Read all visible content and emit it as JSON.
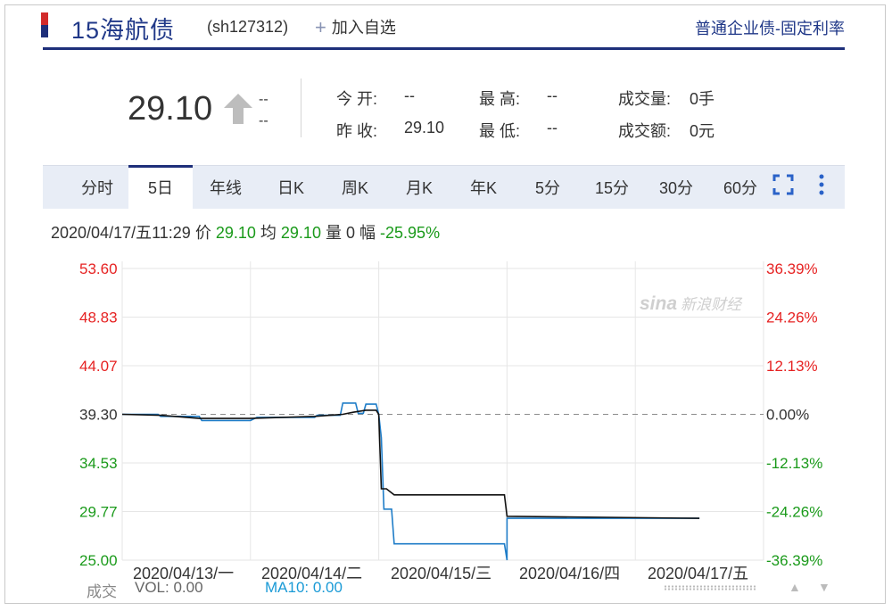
{
  "header": {
    "name": "15海航债",
    "code": "(sh127312)",
    "add_fav_label": "加入自选",
    "bond_type": "普通企业债-固定利率"
  },
  "quote": {
    "price": "29.10",
    "change": "--",
    "change_pct": "--",
    "open_label": "今 开:",
    "open": "--",
    "prev_close_label": "昨 收:",
    "prev_close": "29.10",
    "high_label": "最 高:",
    "high": "--",
    "low_label": "最 低:",
    "low": "--",
    "volume_label": "成交量:",
    "volume": "0手",
    "amount_label": "成交额:",
    "amount": "0元"
  },
  "tabs": [
    "分时",
    "5日",
    "年线",
    "日K",
    "周K",
    "月K",
    "年K",
    "5分",
    "15分",
    "30分",
    "60分"
  ],
  "active_tab": "5日",
  "info": {
    "datetime": "2020/04/17/五11:29",
    "price_label": "价",
    "price": "29.10",
    "avg_label": "均",
    "avg": "29.10",
    "vol_label": "量",
    "vol": "0",
    "range_label": "幅",
    "range": "-25.95%"
  },
  "watermark": "新浪财经",
  "watermark_logo": "sina",
  "colors": {
    "up": "#e62222",
    "down": "#1a9a1a",
    "price_line": "#1f7dc8",
    "avg_line": "#111111",
    "brand": "#1e2f7a"
  },
  "chart_data": {
    "type": "line",
    "y_left_ticks": [
      "53.60",
      "48.83",
      "44.07",
      "39.30",
      "34.53",
      "29.77",
      "25.00"
    ],
    "y_right_ticks": [
      "36.39%",
      "24.26%",
      "12.13%",
      "0.00%",
      "-12.13%",
      "-24.26%",
      "-36.39%"
    ],
    "ylim": [
      25.0,
      53.6
    ],
    "prev_close": 39.3,
    "x_labels": [
      "2020/04/13/一",
      "2020/04/14/二",
      "2020/04/15/三",
      "2020/04/16/四",
      "2020/04/17/五"
    ],
    "x_range": [
      0,
      5
    ],
    "grid": true,
    "series": [
      {
        "key": "price",
        "points": [
          [
            0,
            39.3
          ],
          [
            0.28,
            39.3
          ],
          [
            0.3,
            39.1
          ],
          [
            0.6,
            39.1
          ],
          [
            0.62,
            38.7
          ],
          [
            1.0,
            38.7
          ],
          [
            1.05,
            39.0
          ],
          [
            1.5,
            39.0
          ],
          [
            1.52,
            39.2
          ],
          [
            1.7,
            39.2
          ],
          [
            1.72,
            40.4
          ],
          [
            1.82,
            40.4
          ],
          [
            1.84,
            39.4
          ],
          [
            1.88,
            39.4
          ],
          [
            1.9,
            40.3
          ],
          [
            1.98,
            40.3
          ],
          [
            2.0,
            39.3
          ],
          [
            2.02,
            37.0
          ],
          [
            2.04,
            30.0
          ],
          [
            2.1,
            30.0
          ],
          [
            2.12,
            26.6
          ],
          [
            2.98,
            26.6
          ],
          [
            3.0,
            25.0
          ],
          [
            3.0,
            29.1
          ],
          [
            4.5,
            29.1
          ]
        ]
      },
      {
        "key": "average",
        "points": [
          [
            0,
            39.3
          ],
          [
            0.3,
            39.2
          ],
          [
            0.6,
            38.9
          ],
          [
            1.0,
            38.9
          ],
          [
            1.5,
            39.1
          ],
          [
            1.72,
            39.3
          ],
          [
            1.8,
            39.5
          ],
          [
            1.9,
            39.7
          ],
          [
            1.98,
            39.7
          ],
          [
            2.0,
            39.3
          ],
          [
            2.02,
            32.0
          ],
          [
            2.06,
            32.0
          ],
          [
            2.12,
            31.4
          ],
          [
            2.98,
            31.4
          ],
          [
            3.0,
            29.3
          ],
          [
            4.5,
            29.1
          ]
        ]
      }
    ]
  },
  "bottom": {
    "vol_title": "成交",
    "vol": "VOL: 0.00",
    "ma10": "MA10: 0.00",
    "scroll_up": "▲",
    "scroll_down": "▼"
  }
}
